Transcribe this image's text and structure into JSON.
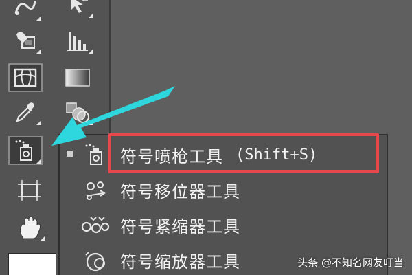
{
  "colors": {
    "panel_bg": "#535353",
    "canvas_bg": "#5f5f5f",
    "highlight_red": "#e8474c",
    "arrow_cyan": "#2ed6de",
    "menu_text": "#f2f2f2"
  },
  "toolbar": {
    "tools": [
      {
        "icon": "pen-curvature-icon"
      },
      {
        "icon": "direct-select-icon"
      },
      {
        "icon": "shape-builder-icon"
      },
      {
        "icon": "graph-icon"
      },
      {
        "icon": "mesh-icon"
      },
      {
        "icon": "gradient-icon"
      },
      {
        "icon": "eyedropper-icon"
      },
      {
        "icon": "blend-icon"
      },
      {
        "icon": "symbol-sprayer-icon"
      },
      {
        "icon": "artboard-icon"
      },
      {
        "icon": "hand-icon"
      }
    ],
    "fill_color": "#ffffff"
  },
  "flyout": {
    "items": [
      {
        "label": "符号喷枪工具",
        "shortcut": "(Shift+S)",
        "icon": "symbol-sprayer-icon",
        "selected": true
      },
      {
        "label": "符号移位器工具",
        "icon": "symbol-shifter-icon"
      },
      {
        "label": "符号紧缩器工具",
        "icon": "symbol-scruncher-icon"
      },
      {
        "label": "符号缩放器工具",
        "icon": "symbol-sizer-icon"
      }
    ]
  },
  "watermark": {
    "text": "头条 @不知名网友叮当"
  }
}
